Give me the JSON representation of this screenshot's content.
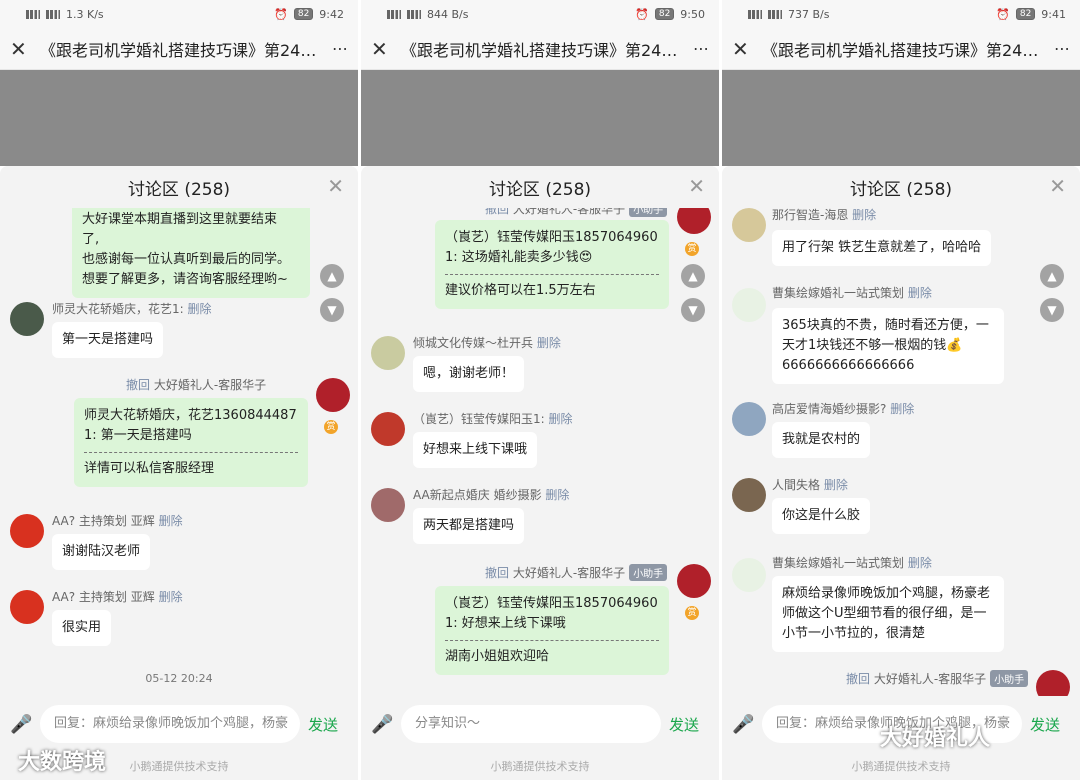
{
  "panels": [
    {
      "status": {
        "net": "1.3 K/s",
        "battery": "82",
        "time": "9:42"
      },
      "title": "《跟老司机学婚礼搭建技巧课》第24期...",
      "sheet_title": "讨论区 (258)",
      "messages": [
        {
          "type": "bubble_only",
          "lines": [
            "大好课堂本期直播到这里就要结束",
            "了,",
            "也感谢每一位认真听到最后的同学。",
            "想要了解更多，请咨询客服经理哟~"
          ]
        },
        {
          "type": "left",
          "name": "师灵大花轿婚庆，花艺1:",
          "del": "删除",
          "text": "第一天是搭建吗"
        },
        {
          "type": "right",
          "rev": "撤回",
          "name": "大好婚礼人-客服华子",
          "tag": "小助手",
          "quote": "师灵大花轿婚庆，花艺1360844487 1: 第一天是搭建吗",
          "reply": "详情可以私信客服经理"
        },
        {
          "type": "left",
          "name": "AA? 主持策划 亚辉",
          "del": "删除",
          "text": "谢谢陆汉老师"
        },
        {
          "type": "left",
          "name": "AA? 主持策划 亚辉",
          "del": "删除",
          "text": "很实用"
        },
        {
          "type": "stamp",
          "text": "05-12 20:24"
        }
      ],
      "input": "回复：麻烦给录像师晚饭加个鸡腿，杨豪",
      "send": "发送",
      "footer": "小鹅通提供技术支持"
    },
    {
      "status": {
        "net": "844 B/s",
        "battery": "82",
        "time": "9:50"
      },
      "title": "《跟老司机学婚礼搭建技巧课》第24期...",
      "sheet_title": "讨论区 (258)",
      "messages": [
        {
          "type": "right",
          "rev": "撤回",
          "name": "大好婚礼人-客服华子",
          "tag": "小助手",
          "quote": "（崀艺）钰莹传媒阳玉1857064960 1: 这场婚礼能卖多少钱😍",
          "reply": "建议价格可以在1.5万左右"
        },
        {
          "type": "left",
          "name": "倾城文化传媒～杜开兵",
          "del": "删除",
          "text": "嗯，谢谢老师！"
        },
        {
          "type": "left",
          "name": "（崀艺）钰莹传媒阳玉1:",
          "del": "删除",
          "text": "好想来上线下课哦"
        },
        {
          "type": "left",
          "name": "AA新起点婚庆 婚纱摄影",
          "del": "删除",
          "text": "两天都是搭建吗"
        },
        {
          "type": "right",
          "rev": "撤回",
          "name": "大好婚礼人-客服华子",
          "tag": "小助手",
          "quote": "（崀艺）钰莹传媒阳玉1857064960 1: 好想来上线下课哦",
          "reply": "湖南小姐姐欢迎哈"
        }
      ],
      "input": "分享知识～",
      "send": "发送",
      "footer": "小鹅通提供技术支持"
    },
    {
      "status": {
        "net": "737 B/s",
        "battery": "82",
        "time": "9:41"
      },
      "title": "《跟老司机学婚礼搭建技巧课》第24期...",
      "sheet_title": "讨论区 (258)",
      "messages": [
        {
          "type": "left",
          "name": "那行智造-海恩",
          "del": "删除",
          "text": "用了行架 铁艺生意就差了，哈哈哈"
        },
        {
          "type": "left",
          "name": "曹集绘嫁婚礼一站式策划",
          "del": "删除",
          "text": "365块真的不贵，随时看还方便，一天才1块钱还不够一根烟的钱💰6666666666666666"
        },
        {
          "type": "left",
          "name": "高店爱情海婚纱摄影?",
          "del": "删除",
          "text": "我就是农村的"
        },
        {
          "type": "left",
          "name": "人間失格",
          "del": "删除",
          "text": "你这是什么胶"
        },
        {
          "type": "left",
          "name": "曹集绘嫁婚礼一站式策划",
          "del": "删除",
          "text": "麻烦给录像师晚饭加个鸡腿，杨豪老师做这个U型细节看的很仔细，是一小节一小节拉的，很清楚"
        },
        {
          "type": "right_header",
          "rev": "撤回",
          "name": "大好婚礼人-客服华子",
          "tag": "小助手"
        }
      ],
      "input": "回复：麻烦给录像师晚饭加个鸡腿，杨豪",
      "send": "发送",
      "footer": "小鹅通提供技术支持"
    }
  ],
  "watermarks": {
    "left": "大数跨境",
    "right": "大好婚礼人"
  },
  "colors": {
    "accent": "#19a64b",
    "bubble_green": "#dcf5d8",
    "badge": "#f2a42a"
  }
}
